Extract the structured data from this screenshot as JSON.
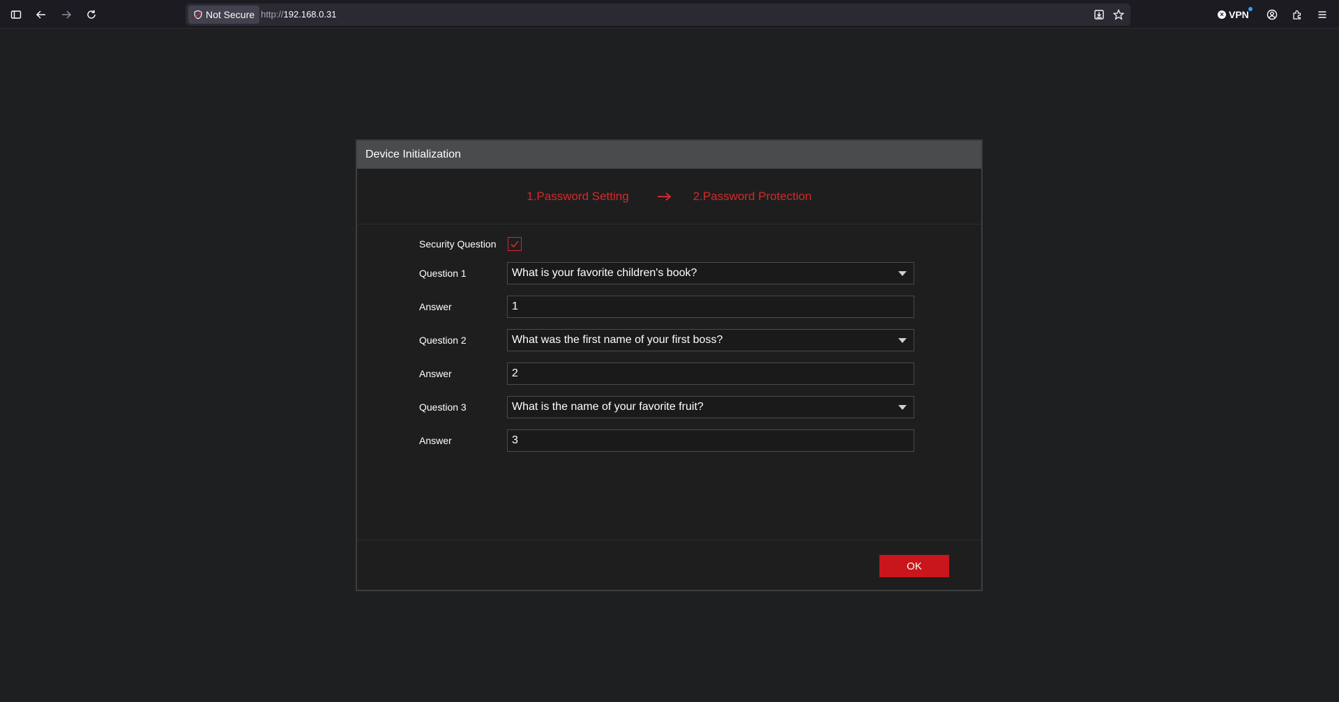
{
  "browser": {
    "security_label": "Not Secure",
    "url_scheme": "http://",
    "url_host": "192.168.0.31",
    "vpn_label": "VPN"
  },
  "dialog": {
    "title": "Device Initialization",
    "steps": [
      {
        "label": "1.Password Setting"
      },
      {
        "label": "2.Password Protection"
      }
    ],
    "security_question": {
      "label": "Security Question",
      "checked": true
    },
    "rows": [
      {
        "question_label": "Question 1",
        "question_value": "What is your favorite children's book?",
        "answer_label": "Answer",
        "answer_value": "1"
      },
      {
        "question_label": "Question 2",
        "question_value": "What was the first name of your first boss?",
        "answer_label": "Answer",
        "answer_value": "2"
      },
      {
        "question_label": "Question 3",
        "question_value": "What is the name of your favorite fruit?",
        "answer_label": "Answer",
        "answer_value": "3"
      }
    ],
    "ok_label": "OK"
  },
  "colors": {
    "accent": "#c9161c",
    "step_text": "#d22a2a",
    "header_bg": "#4a4b4d",
    "page_bg": "#1e1f20"
  }
}
